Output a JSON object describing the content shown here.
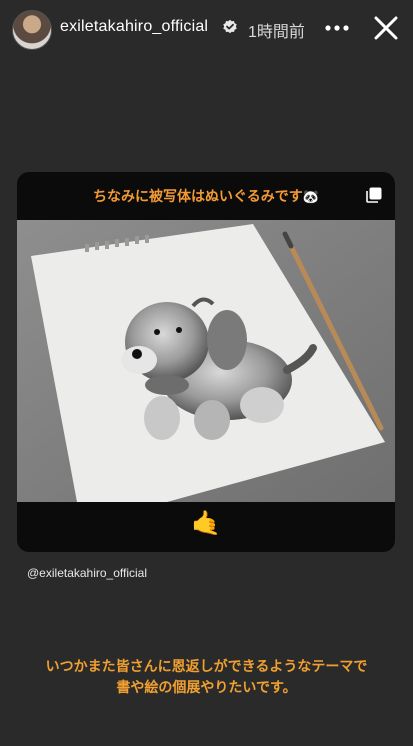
{
  "header": {
    "username": "exiletakahiro_official",
    "time": "1時間前"
  },
  "card": {
    "caption": "ちなみに被写体はぬいぐるみです",
    "caption_emoji": "🐼",
    "bottom_emoji": "🤙"
  },
  "mention": "@exiletakahiro_official",
  "bottom_text": {
    "line1": "いつかまた皆さんに恩返しができるようなテーマで",
    "line2": "書や絵の個展やりたいです。"
  },
  "colors": {
    "background": "#2a2a2a",
    "accent_text": "#f0a030"
  },
  "icons": [
    "avatar",
    "verified-badge-icon",
    "more-options-icon",
    "close-icon",
    "copy-icon"
  ]
}
